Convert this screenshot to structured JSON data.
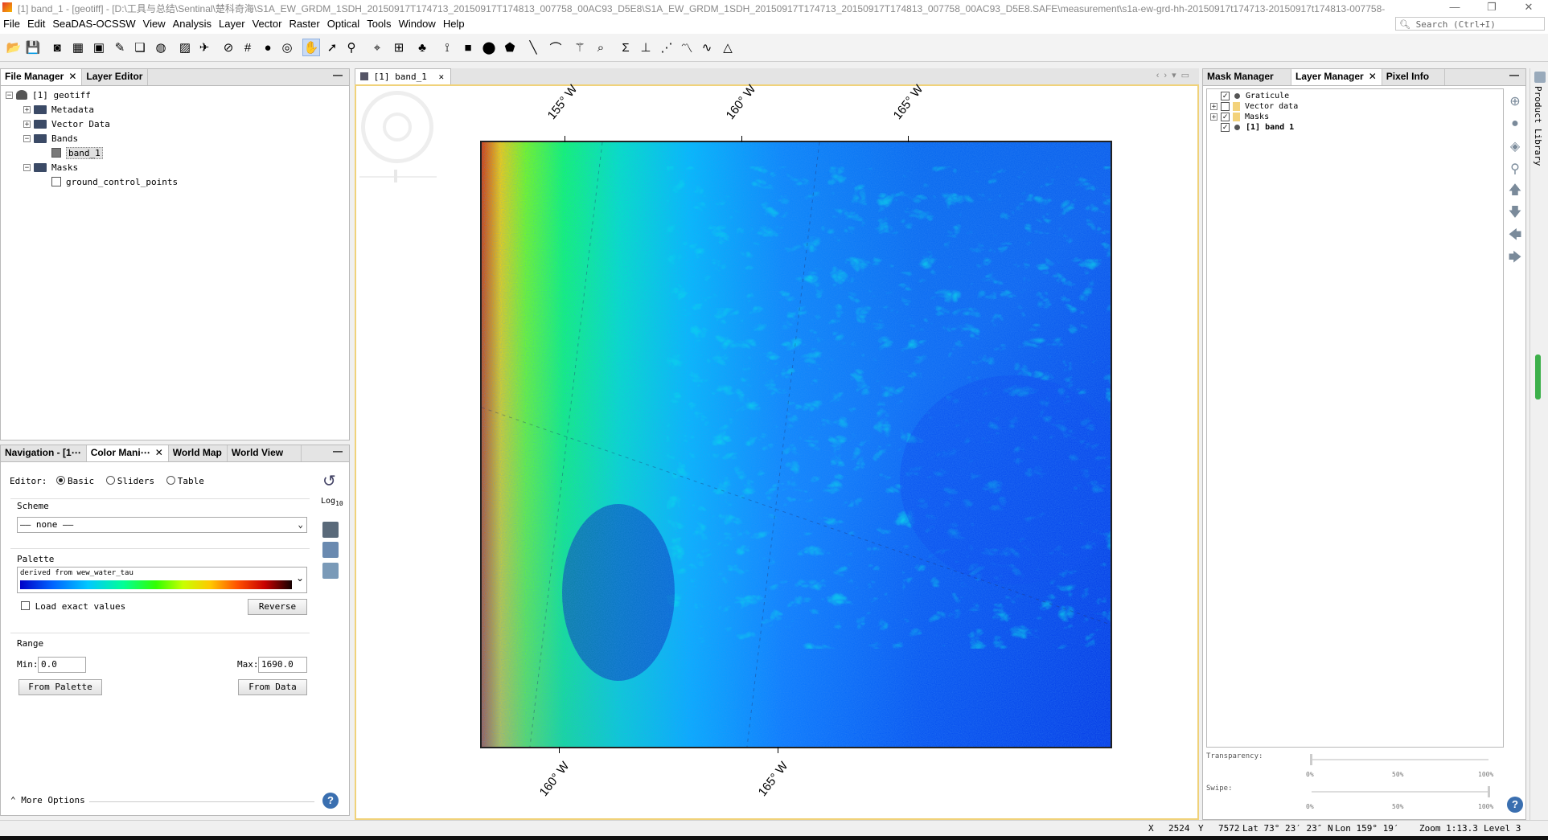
{
  "window": {
    "title": "[1] band_1 - [geotiff] - [D:\\工具与总结\\Sentinal\\楚科奇海\\S1A_EW_GRDM_1SDH_20150917T174713_20150917T174813_007758_00AC93_D5E8\\S1A_EW_GRDM_1SDH_20150917T174713_20150917T174813_007758_00AC93_D5E8.SAFE\\measurement\\s1a-ew-grd-hh-20150917t174713-20150917t174813-007758-",
    "minimize": "—",
    "restore": "❐",
    "close": "✕"
  },
  "menubar": {
    "items": [
      "File",
      "Edit",
      "SeaDAS-OCSSW",
      "View",
      "Analysis",
      "Layer",
      "Vector",
      "Raster",
      "Optical",
      "Tools",
      "Window",
      "Help"
    ],
    "search_placeholder": "Search (Ctrl+I)"
  },
  "toolbar": {
    "icons": [
      "open-product-icon",
      "save-product-icon",
      "seadas-logo-icon",
      "ocssw-icon",
      "stack-icon",
      "wizard-icon",
      "layers-icon",
      "globe-icon",
      "image-icon",
      "satellite-icon",
      "no-data-icon",
      "grid-icon",
      "sphere-icon",
      "graticule-icon",
      "pan-tool-icon",
      "select-tool-icon",
      "zoom-tool-icon",
      "pin-tool-icon",
      "gcp-tool-icon",
      "mask-icon",
      "range-finder-icon",
      "draw-rectangle-icon",
      "draw-ellipse-icon",
      "draw-polygon-icon",
      "draw-line-icon",
      "draw-polyline-icon",
      "magic-wand-icon",
      "magic-wand-zoom-icon",
      "statistics-icon",
      "histogram-icon",
      "scatter-plot-icon",
      "profile-plot-icon",
      "spectrum-icon",
      "information-icon"
    ]
  },
  "file_manager": {
    "tabs": [
      {
        "label": "File Manager",
        "closable": true
      },
      {
        "label": "Layer Editor",
        "closable": false
      }
    ],
    "tree": [
      {
        "label": "[1]  geotiff",
        "indent": 0,
        "icon": "product-icon",
        "expander": "−"
      },
      {
        "label": "Metadata",
        "indent": 1,
        "icon": "folder-icon",
        "expander": "+"
      },
      {
        "label": "Vector Data",
        "indent": 1,
        "icon": "folder-icon",
        "expander": "+"
      },
      {
        "label": "Bands",
        "indent": 1,
        "icon": "folder-icon",
        "expander": "−"
      },
      {
        "label": "band_1",
        "indent": 2,
        "icon": "band-icon",
        "selected": true
      },
      {
        "label": "Masks",
        "indent": 1,
        "icon": "folder-icon",
        "expander": "−"
      },
      {
        "label": "ground_control_points",
        "indent": 2,
        "icon": "mask-icon"
      }
    ]
  },
  "color_panel": {
    "tabs": [
      "Navigation - [1⋯",
      "Color Mani⋯",
      "World Map",
      "World View"
    ],
    "editor_label": "Editor:",
    "editor_options": [
      "Basic",
      "Sliders",
      "Table"
    ],
    "scheme_label": "Scheme",
    "scheme_value": "—— none ——",
    "log_label": "Log",
    "log_sub": "10",
    "palette_label": "Palette",
    "palette_name": "derived from wew_water_tau",
    "load_exact_label": "Load exact values",
    "reverse_label": "Reverse",
    "range_label": "Range",
    "min_label": "Min:",
    "min_value": "0.0",
    "max_label": "Max:",
    "max_value": "1690.0",
    "from_palette_label": "From Palette",
    "from_data_label": "From Data",
    "more_options_label": "More Options"
  },
  "image_view": {
    "tab_label": "[1] band_1",
    "top_labels": [
      "155° W",
      "160° W",
      "165° W"
    ],
    "bottom_labels": [
      "160° W",
      "165° W"
    ]
  },
  "layer_manager": {
    "tabs": [
      {
        "label": "Mask Manager",
        "closable": false
      },
      {
        "label": "Layer Manager",
        "closable": true
      },
      {
        "label": "Pixel Info",
        "closable": false
      }
    ],
    "layers": [
      {
        "label": "Graticule",
        "checked": true,
        "expander": "",
        "bold": false
      },
      {
        "label": "Vector data",
        "checked": false,
        "expander": "+",
        "bold": false
      },
      {
        "label": "Masks",
        "checked": true,
        "expander": "+",
        "bold": false
      },
      {
        "label": "[1] band 1",
        "checked": true,
        "expander": "",
        "bold": true
      }
    ],
    "transparency_label": "Transparency:",
    "swipe_label": "Swipe:",
    "scale_ticks": [
      "0%",
      "50%",
      "100%"
    ]
  },
  "right_sidebar": {
    "title": "Product Library"
  },
  "statusbar": {
    "x_label": "X",
    "x_value": "2524",
    "y_label": "Y",
    "y_value": "7572",
    "lat": "Lat 73° 23′ 23″ N",
    "lon": "Lon 159° 19′",
    "zoom": "Zoom 1:13.3",
    "level": "Level 3"
  }
}
